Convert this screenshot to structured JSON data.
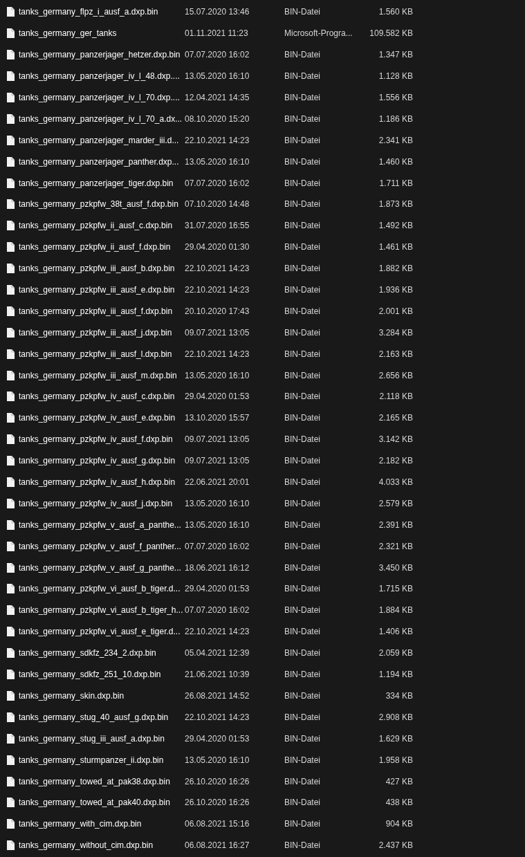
{
  "files": [
    {
      "name": "tanks_germany_flpz_i_ausf_a.dxp.bin",
      "modified": "15.07.2020 13:46",
      "type": "BIN-Datei",
      "size": "1.560 KB"
    },
    {
      "name": "tanks_germany_ger_tanks",
      "modified": "01.11.2021 11:23",
      "type": "Microsoft-Progra...",
      "size": "109.582 KB"
    },
    {
      "name": "tanks_germany_panzerjager_hetzer.dxp.bin",
      "modified": "07.07.2020 16:02",
      "type": "BIN-Datei",
      "size": "1.347 KB"
    },
    {
      "name": "tanks_germany_panzerjager_iv_l_48.dxp....",
      "modified": "13.05.2020 16:10",
      "type": "BIN-Datei",
      "size": "1.128 KB"
    },
    {
      "name": "tanks_germany_panzerjager_iv_l_70.dxp....",
      "modified": "12.04.2021 14:35",
      "type": "BIN-Datei",
      "size": "1.556 KB"
    },
    {
      "name": "tanks_germany_panzerjager_iv_l_70_a.dx...",
      "modified": "08.10.2020 15:20",
      "type": "BIN-Datei",
      "size": "1.186 KB"
    },
    {
      "name": "tanks_germany_panzerjager_marder_iii.d...",
      "modified": "22.10.2021 14:23",
      "type": "BIN-Datei",
      "size": "2.341 KB"
    },
    {
      "name": "tanks_germany_panzerjager_panther.dxp...",
      "modified": "13.05.2020 16:10",
      "type": "BIN-Datei",
      "size": "1.460 KB"
    },
    {
      "name": "tanks_germany_panzerjager_tiger.dxp.bin",
      "modified": "07.07.2020 16:02",
      "type": "BIN-Datei",
      "size": "1.711 KB"
    },
    {
      "name": "tanks_germany_pzkpfw_38t_ausf_f.dxp.bin",
      "modified": "07.10.2020 14:48",
      "type": "BIN-Datei",
      "size": "1.873 KB"
    },
    {
      "name": "tanks_germany_pzkpfw_ii_ausf_c.dxp.bin",
      "modified": "31.07.2020 16:55",
      "type": "BIN-Datei",
      "size": "1.492 KB"
    },
    {
      "name": "tanks_germany_pzkpfw_ii_ausf_f.dxp.bin",
      "modified": "29.04.2020 01:30",
      "type": "BIN-Datei",
      "size": "1.461 KB"
    },
    {
      "name": "tanks_germany_pzkpfw_iii_ausf_b.dxp.bin",
      "modified": "22.10.2021 14:23",
      "type": "BIN-Datei",
      "size": "1.882 KB"
    },
    {
      "name": "tanks_germany_pzkpfw_iii_ausf_e.dxp.bin",
      "modified": "22.10.2021 14:23",
      "type": "BIN-Datei",
      "size": "1.936 KB"
    },
    {
      "name": "tanks_germany_pzkpfw_iii_ausf_f.dxp.bin",
      "modified": "20.10.2020 17:43",
      "type": "BIN-Datei",
      "size": "2.001 KB"
    },
    {
      "name": "tanks_germany_pzkpfw_iii_ausf_j.dxp.bin",
      "modified": "09.07.2021 13:05",
      "type": "BIN-Datei",
      "size": "3.284 KB"
    },
    {
      "name": "tanks_germany_pzkpfw_iii_ausf_l.dxp.bin",
      "modified": "22.10.2021 14:23",
      "type": "BIN-Datei",
      "size": "2.163 KB"
    },
    {
      "name": "tanks_germany_pzkpfw_iii_ausf_m.dxp.bin",
      "modified": "13.05.2020 16:10",
      "type": "BIN-Datei",
      "size": "2.656 KB"
    },
    {
      "name": "tanks_germany_pzkpfw_iv_ausf_c.dxp.bin",
      "modified": "29.04.2020 01:53",
      "type": "BIN-Datei",
      "size": "2.118 KB"
    },
    {
      "name": "tanks_germany_pzkpfw_iv_ausf_e.dxp.bin",
      "modified": "13.10.2020 15:57",
      "type": "BIN-Datei",
      "size": "2.165 KB"
    },
    {
      "name": "tanks_germany_pzkpfw_iv_ausf_f.dxp.bin",
      "modified": "09.07.2021 13:05",
      "type": "BIN-Datei",
      "size": "3.142 KB"
    },
    {
      "name": "tanks_germany_pzkpfw_iv_ausf_g.dxp.bin",
      "modified": "09.07.2021 13:05",
      "type": "BIN-Datei",
      "size": "2.182 KB"
    },
    {
      "name": "tanks_germany_pzkpfw_iv_ausf_h.dxp.bin",
      "modified": "22.06.2021 20:01",
      "type": "BIN-Datei",
      "size": "4.033 KB"
    },
    {
      "name": "tanks_germany_pzkpfw_iv_ausf_j.dxp.bin",
      "modified": "13.05.2020 16:10",
      "type": "BIN-Datei",
      "size": "2.579 KB"
    },
    {
      "name": "tanks_germany_pzkpfw_v_ausf_a_panthe...",
      "modified": "13.05.2020 16:10",
      "type": "BIN-Datei",
      "size": "2.391 KB"
    },
    {
      "name": "tanks_germany_pzkpfw_v_ausf_f_panther...",
      "modified": "07.07.2020 16:02",
      "type": "BIN-Datei",
      "size": "2.321 KB"
    },
    {
      "name": "tanks_germany_pzkpfw_v_ausf_g_panthe...",
      "modified": "18.06.2021 16:12",
      "type": "BIN-Datei",
      "size": "3.450 KB"
    },
    {
      "name": "tanks_germany_pzkpfw_vi_ausf_b_tiger.d...",
      "modified": "29.04.2020 01:53",
      "type": "BIN-Datei",
      "size": "1.715 KB"
    },
    {
      "name": "tanks_germany_pzkpfw_vi_ausf_b_tiger_h...",
      "modified": "07.07.2020 16:02",
      "type": "BIN-Datei",
      "size": "1.884 KB"
    },
    {
      "name": "tanks_germany_pzkpfw_vi_ausf_e_tiger.d...",
      "modified": "22.10.2021 14:23",
      "type": "BIN-Datei",
      "size": "1.406 KB"
    },
    {
      "name": "tanks_germany_sdkfz_234_2.dxp.bin",
      "modified": "05.04.2021 12:39",
      "type": "BIN-Datei",
      "size": "2.059 KB"
    },
    {
      "name": "tanks_germany_sdkfz_251_10.dxp.bin",
      "modified": "21.06.2021 10:39",
      "type": "BIN-Datei",
      "size": "1.194 KB"
    },
    {
      "name": "tanks_germany_skin.dxp.bin",
      "modified": "26.08.2021 14:52",
      "type": "BIN-Datei",
      "size": "334 KB"
    },
    {
      "name": "tanks_germany_stug_40_ausf_g.dxp.bin",
      "modified": "22.10.2021 14:23",
      "type": "BIN-Datei",
      "size": "2.908 KB"
    },
    {
      "name": "tanks_germany_stug_iii_ausf_a.dxp.bin",
      "modified": "29.04.2020 01:53",
      "type": "BIN-Datei",
      "size": "1.629 KB"
    },
    {
      "name": "tanks_germany_sturmpanzer_ii.dxp.bin",
      "modified": "13.05.2020 16:10",
      "type": "BIN-Datei",
      "size": "1.958 KB"
    },
    {
      "name": "tanks_germany_towed_at_pak38.dxp.bin",
      "modified": "26.10.2020 16:26",
      "type": "BIN-Datei",
      "size": "427 KB"
    },
    {
      "name": "tanks_germany_towed_at_pak40.dxp.bin",
      "modified": "26.10.2020 16:26",
      "type": "BIN-Datei",
      "size": "438 KB"
    },
    {
      "name": "tanks_germany_with_cim.dxp.bin",
      "modified": "06.08.2021 15:16",
      "type": "BIN-Datei",
      "size": "904 KB"
    },
    {
      "name": "tanks_germany_without_cim.dxp.bin",
      "modified": "06.08.2021 16:27",
      "type": "BIN-Datei",
      "size": "2.437 KB"
    }
  ]
}
